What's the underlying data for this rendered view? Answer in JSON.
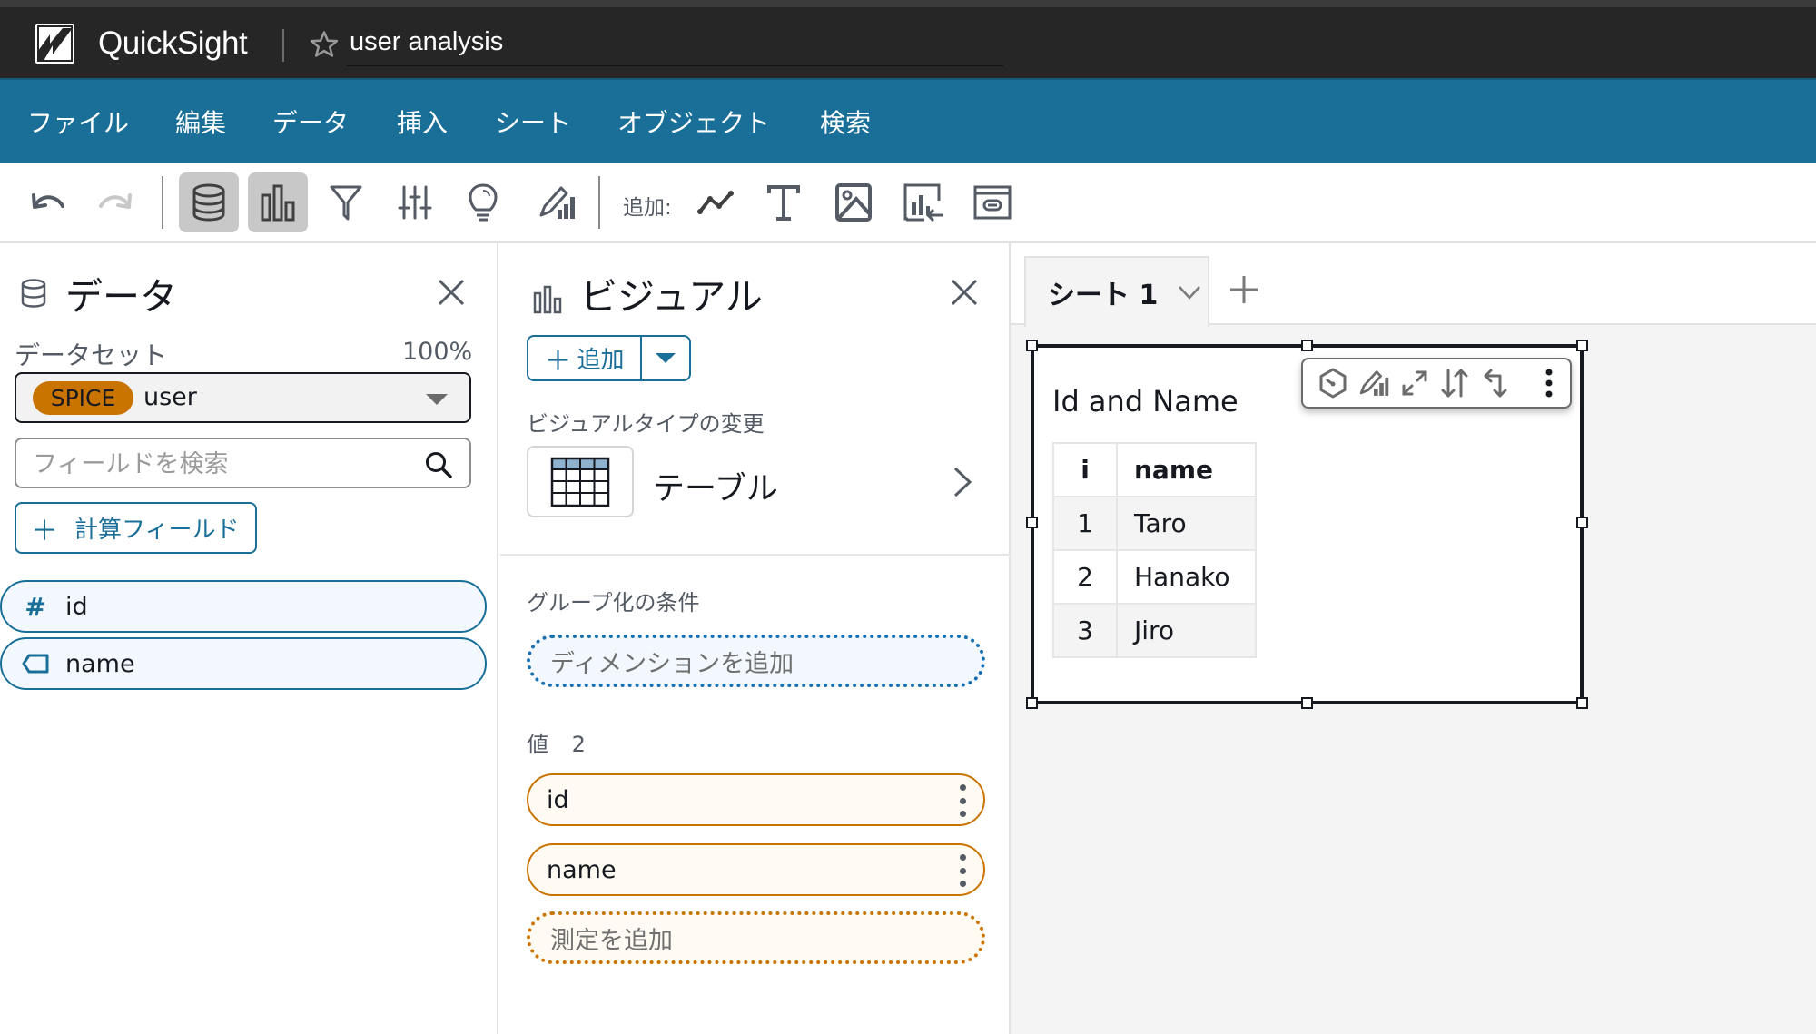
{
  "app": {
    "name": "QuickSight",
    "analysis_name": "user analysis"
  },
  "menu": {
    "items": [
      {
        "label": "ファイル"
      },
      {
        "label": "編集"
      },
      {
        "label": "データ"
      },
      {
        "label": "挿入"
      },
      {
        "label": "シート"
      },
      {
        "label": "オブジェクト"
      },
      {
        "label": "検索"
      }
    ]
  },
  "toolbar": {
    "icons": [
      "undo-icon",
      "redo-icon",
      "database-icon",
      "bar-chart-icon",
      "filter-icon",
      "sliders-icon",
      "lightbulb-icon",
      "pencil-chart-icon"
    ],
    "active": [
      "database-icon",
      "bar-chart-icon"
    ],
    "add_label": "追加:",
    "add_icons": [
      "line-chart-icon",
      "text-icon",
      "image-icon",
      "embed-chart-icon",
      "link-card-icon"
    ]
  },
  "data_panel": {
    "title": "データ",
    "dataset_label": "データセット",
    "dataset_percent": "100%",
    "dataset_badge": "SPICE",
    "dataset_name": "user",
    "search_placeholder": "フィールドを検索",
    "search_value": "",
    "calc_field_label": "計算フィールド",
    "fields": [
      {
        "name": "id",
        "type": "number",
        "icon": "#"
      },
      {
        "name": "name",
        "type": "string",
        "icon": "tag"
      }
    ]
  },
  "visual_panel": {
    "title": "ビジュアル",
    "add_label": "追加",
    "change_type_label": "ビジュアルタイプの変更",
    "visual_type": "テーブル",
    "group_by_label": "グループ化の条件",
    "add_dimension_placeholder": "ディメンションを追加",
    "values_label": "値",
    "values_count": "2",
    "values": [
      {
        "name": "id"
      },
      {
        "name": "name"
      }
    ],
    "add_measure_placeholder": "測定を追加"
  },
  "sheet": {
    "tab_label": "シート 1",
    "visual": {
      "title": "Id and Name",
      "columns": [
        "i",
        "name"
      ],
      "rows": [
        [
          "1",
          "Taro"
        ],
        [
          "2",
          "Hanako"
        ],
        [
          "3",
          "Jiro"
        ]
      ]
    }
  },
  "colors": {
    "brand_blue": "#1a6f98",
    "spice_orange": "#c97400",
    "topbar": "#262626"
  }
}
